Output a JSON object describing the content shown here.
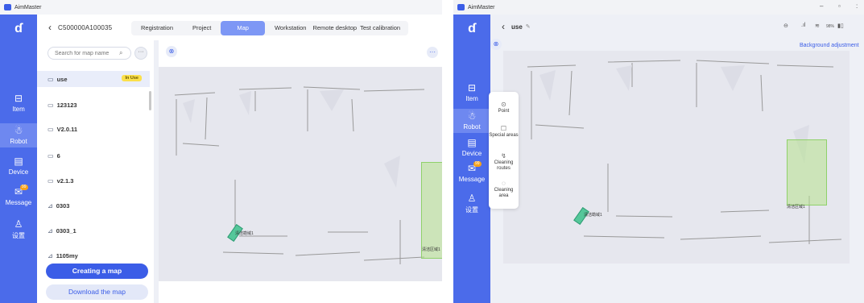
{
  "app": {
    "title": "AimMaster"
  },
  "window1": {
    "nav": [
      {
        "label": "Item",
        "icon": "item-icon"
      },
      {
        "label": "Robot",
        "icon": "robot-icon"
      },
      {
        "label": "Device",
        "icon": "device-icon"
      },
      {
        "label": "Message",
        "icon": "message-icon",
        "badge": "99"
      },
      {
        "label": "设置",
        "icon": "settings-icon"
      }
    ],
    "robot_id": "C500000A100035",
    "tabs": [
      "Registration",
      "Project",
      "Map",
      "Workstation",
      "Remote desktop",
      "Test calibration"
    ],
    "selected_tab": "Map",
    "search_placeholder": "Search for map name",
    "maps": [
      {
        "name": "use",
        "badge": "In Use",
        "icon": "map-icon"
      },
      {
        "name": "123123",
        "icon": "map-icon"
      },
      {
        "name": "V2.0.11",
        "icon": "map-icon"
      },
      {
        "name": "6",
        "icon": "map-icon"
      },
      {
        "name": "v2.1.3",
        "icon": "map-icon"
      },
      {
        "name": "0303",
        "icon": "map-alt-icon"
      },
      {
        "name": "0303_1",
        "icon": "map-alt-icon"
      },
      {
        "name": "1105my",
        "icon": "map-alt-icon"
      }
    ],
    "create_label": "Creating a map",
    "download_label": "Download the map",
    "dock_label": "清洁勘域1",
    "area_label": "清洁区域1"
  },
  "window2": {
    "map_name": "use",
    "battery": "98%",
    "background_adjust_label": "Background adjustment",
    "menu": [
      {
        "label": "Point",
        "icon": "point-icon"
      },
      {
        "label": "Special areas",
        "icon": "special-areas-icon"
      },
      {
        "label": "Cleaning routes",
        "icon": "routes-icon"
      },
      {
        "label": "Cleaning area",
        "icon": "area-icon"
      }
    ],
    "dock_label": "清洁勘域1",
    "area_label": "清洁区域1"
  },
  "colors": {
    "primary": "#3b5de7",
    "rail": "#4b6bea",
    "in_use_badge": "#fbe04b",
    "area_fill": "#b7e18e",
    "dock": "#55c79a"
  }
}
